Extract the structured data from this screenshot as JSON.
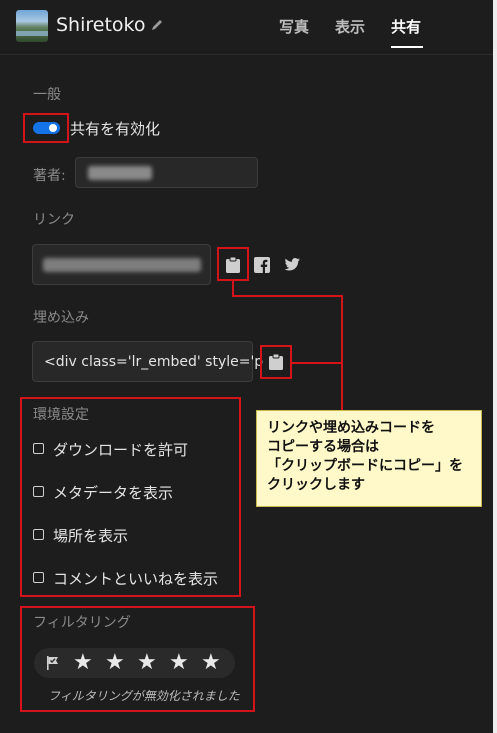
{
  "header": {
    "album_title": "Shiretoko",
    "tabs": [
      "写真",
      "表示",
      "共有"
    ],
    "active_tab": "共有"
  },
  "general": {
    "section_label": "一般",
    "enable_sharing_label": "共有を有効化",
    "enable_sharing_on": true,
    "author_label": "著者:"
  },
  "link": {
    "section_label": "リンク"
  },
  "embed": {
    "section_label": "埋め込み",
    "code_preview": "<div class='lr_embed' style='p  ..."
  },
  "settings": {
    "section_label": "環境設定",
    "options": [
      {
        "label": "ダウンロードを許可",
        "checked": false
      },
      {
        "label": "メタデータを表示",
        "checked": false
      },
      {
        "label": "場所を表示",
        "checked": false
      },
      {
        "label": "コメントといいねを表示",
        "checked": false
      }
    ]
  },
  "filtering": {
    "section_label": "フィルタリング",
    "stars": [
      "★",
      "★",
      "★",
      "★",
      "★"
    ],
    "disabled_note": "フィルタリングが無効化されました"
  },
  "callout": {
    "lines": [
      "リンクや埋め込みコードを",
      "コピーする場合は",
      "「クリップボードにコピー」を",
      "クリックします"
    ]
  },
  "colors": {
    "accent": "#1473e6",
    "annotation_red": "#d6131b",
    "callout_bg": "#fff9c9"
  },
  "icons": {
    "edit": "pencil-icon",
    "copy": "clipboard-icon",
    "facebook": "facebook-icon",
    "twitter": "twitter-icon",
    "flag": "flag-icon"
  }
}
